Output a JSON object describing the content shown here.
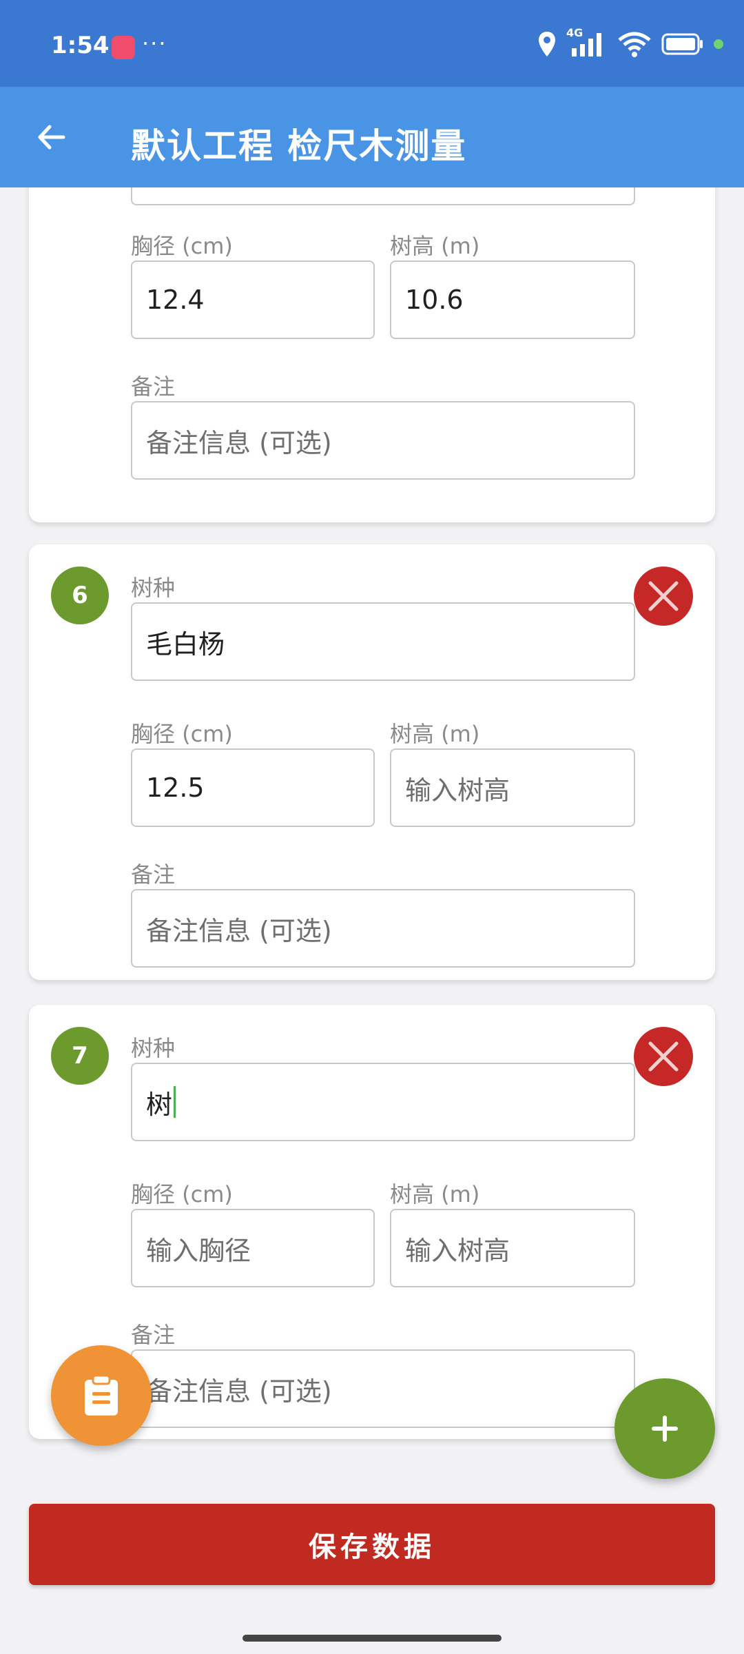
{
  "status_bar": {
    "time": "1:54",
    "more": "···",
    "network": "4G"
  },
  "app_bar": {
    "title": "默认工程 检尺木测量"
  },
  "labels": {
    "species": "树种",
    "dbh": "胸径 (cm)",
    "height": "树高 (m)",
    "note": "备注"
  },
  "placeholders": {
    "dbh": "输入胸径",
    "height": "输入树高",
    "note": "备注信息 (可选)"
  },
  "records": [
    {
      "species": "",
      "dbh": "12.4",
      "height": "10.6",
      "note": ""
    },
    {
      "index": "6",
      "species": "毛白杨",
      "dbh": "12.5",
      "height": "",
      "note": ""
    },
    {
      "index": "7",
      "species": "树",
      "dbh": "",
      "height": "",
      "note": ""
    }
  ],
  "save_button": "保存数据",
  "colors": {
    "status_bar": "#3a78d2",
    "app_bar": "#4a94e6",
    "index_badge": "#6c9a2c",
    "delete": "#c62828",
    "save": "#c12a21",
    "fab_left": "#f09236",
    "fab_right": "#6c9a2c"
  },
  "icons": {
    "back": "arrow-left-icon",
    "delete": "close-icon",
    "clipboard": "clipboard-icon",
    "add": "plus-icon"
  }
}
